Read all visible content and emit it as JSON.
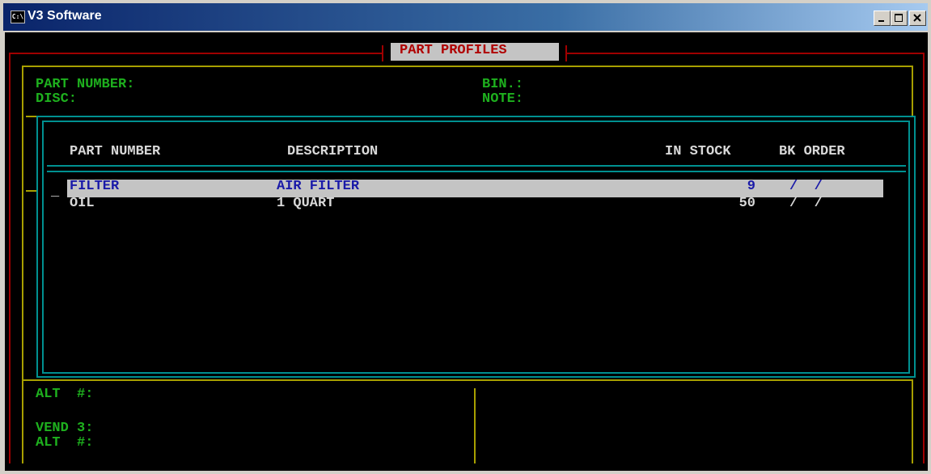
{
  "window": {
    "title": "V3 Software",
    "icon": "console-icon",
    "controls": [
      "minimize-icon",
      "maximize-icon",
      "close-icon"
    ]
  },
  "screen": {
    "header": "PART PROFILES",
    "fields": {
      "part_number": "PART NUMBER:",
      "disc": "DISC:",
      "bin": "BIN.:",
      "note": "NOTE:"
    },
    "list": {
      "columns": [
        "PART NUMBER",
        "DESCRIPTION",
        "IN STOCK",
        "BK ORDER"
      ],
      "cursor": "_",
      "rows": [
        {
          "part_number": "FILTER",
          "description": "AIR FILTER",
          "in_stock": "9",
          "bk_order": "/  /",
          "selected": true
        },
        {
          "part_number": "OIL",
          "description": "1 QUART",
          "in_stock": "50",
          "bk_order": "/  /",
          "selected": false
        }
      ]
    },
    "bottom": {
      "alt1": "ALT  #:",
      "vend3": "VEND 3:",
      "alt2": "ALT  #:"
    }
  },
  "colors": {
    "title_bar": "#0a246a",
    "console_bg": "#000000",
    "label_green": "#1eb01e",
    "header_red": "#b00000",
    "frame_red": "#a00000",
    "frame_yellow": "#a8a000",
    "frame_teal": "#009090",
    "selection": "#c4c4c4",
    "selected_text": "#1a1aa8"
  }
}
